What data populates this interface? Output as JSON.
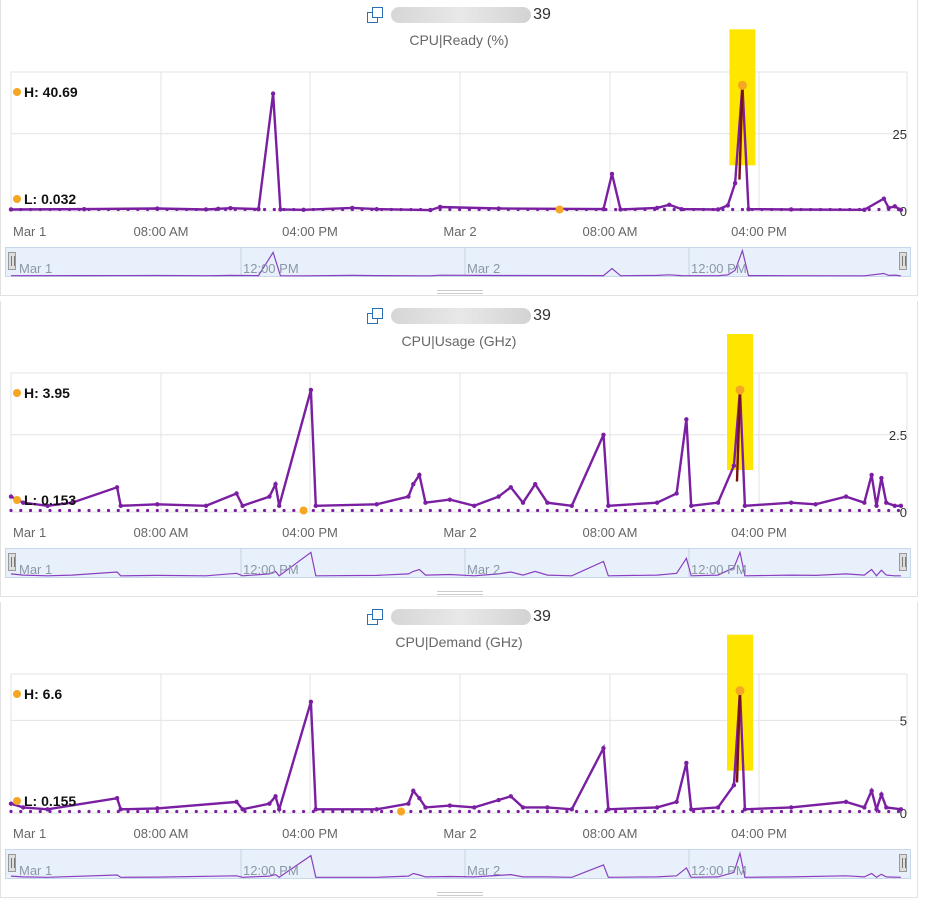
{
  "colors": {
    "series": "#7a1fa2",
    "marker": "#f5a623",
    "highlight": "#ffe600",
    "grid": "#e3e3e3",
    "nav_bg": "#e8f1fb"
  },
  "icons": {
    "object": "virtual-machine-icon"
  },
  "x_axis_labels": [
    "Mar 1",
    "08:00 AM",
    "04:00 PM",
    "Mar 2",
    "08:00 AM",
    "04:00 PM"
  ],
  "navigator_labels": [
    "Mar 1",
    "12:00 PM",
    "Mar 2",
    "12:00 PM"
  ],
  "panels": [
    {
      "object_suffix": "39",
      "metric": "CPU|Ready (%)",
      "high_label": "H: 40.69",
      "low_label": "L: 0.032",
      "yticks": [
        "25",
        "0"
      ]
    },
    {
      "object_suffix": "39",
      "metric": "CPU|Usage (GHz)",
      "high_label": "H: 3.95",
      "low_label": "L: 0.153",
      "yticks": [
        "2.5",
        "0"
      ]
    },
    {
      "object_suffix": "39",
      "metric": "CPU|Demand (GHz)",
      "high_label": "H: 6.6",
      "low_label": "L: 0.155",
      "yticks": [
        "5",
        "0"
      ]
    }
  ],
  "chart_data": [
    {
      "type": "line",
      "title": "CPU|Ready (%)",
      "x_range_hours": [
        0,
        48
      ],
      "ylim": [
        0,
        45
      ],
      "y_ticks": [
        0,
        25
      ],
      "high": 40.69,
      "low": 0.032,
      "series": [
        {
          "points": [
            [
              0,
              0.5
            ],
            [
              6,
              0.6
            ],
            [
              12,
              0.8
            ],
            [
              16,
              0.5
            ],
            [
              17,
              0.7
            ],
            [
              18,
              0.9
            ],
            [
              20.3,
              0.6
            ],
            [
              21.5,
              38
            ],
            [
              22.1,
              0.5
            ],
            [
              24,
              0.4
            ],
            [
              28,
              1.0
            ],
            [
              30,
              0.6
            ],
            [
              34.4,
              0.3
            ],
            [
              35.2,
              1.3
            ],
            [
              40,
              0.8
            ],
            [
              48.6,
              0.6
            ],
            [
              49.3,
              12
            ],
            [
              50,
              0.5
            ],
            [
              53,
              1.0
            ],
            [
              54,
              2.0
            ],
            [
              55,
              0.6
            ],
            [
              58,
              0.5
            ],
            [
              58.8,
              1.8
            ],
            [
              59.4,
              9
            ],
            [
              60,
              40.69
            ],
            [
              60.5,
              0.6
            ],
            [
              64,
              0.5
            ],
            [
              70,
              0.4
            ],
            [
              71.6,
              4
            ],
            [
              72,
              1.0
            ],
            [
              72.5,
              1.5
            ],
            [
              73,
              0.4
            ]
          ]
        }
      ]
    },
    {
      "type": "line",
      "title": "CPU|Usage (GHz)",
      "x_range_hours": [
        0,
        48
      ],
      "ylim": [
        0,
        4.5
      ],
      "y_ticks": [
        0,
        2.5
      ],
      "high": 3.95,
      "low": 0.153,
      "series": [
        {
          "points": [
            [
              0,
              0.5
            ],
            [
              1,
              0.3
            ],
            [
              3,
              0.2
            ],
            [
              5,
              0.3
            ],
            [
              8.7,
              0.8
            ],
            [
              9,
              0.2
            ],
            [
              12,
              0.25
            ],
            [
              16,
              0.2
            ],
            [
              18.5,
              0.6
            ],
            [
              19,
              0.2
            ],
            [
              21.2,
              0.5
            ],
            [
              21.7,
              0.9
            ],
            [
              22,
              0.2
            ],
            [
              24.6,
              3.95
            ],
            [
              25,
              0.2
            ],
            [
              30,
              0.25
            ],
            [
              32.6,
              0.5
            ],
            [
              33,
              0.9
            ],
            [
              33.5,
              1.2
            ],
            [
              34,
              0.3
            ],
            [
              36,
              0.4
            ],
            [
              38,
              0.2
            ],
            [
              40,
              0.5
            ],
            [
              41,
              0.8
            ],
            [
              42,
              0.3
            ],
            [
              43,
              0.9
            ],
            [
              44,
              0.3
            ],
            [
              46,
              0.2
            ],
            [
              48.6,
              2.5
            ],
            [
              49,
              0.2
            ],
            [
              53,
              0.3
            ],
            [
              54.6,
              0.6
            ],
            [
              55.4,
              3.0
            ],
            [
              55.8,
              0.2
            ],
            [
              58,
              0.3
            ],
            [
              59.3,
              1.5
            ],
            [
              59.8,
              3.95
            ],
            [
              60.2,
              0.2
            ],
            [
              64,
              0.3
            ],
            [
              66,
              0.25
            ],
            [
              68.5,
              0.5
            ],
            [
              70,
              0.3
            ],
            [
              70.6,
              1.2
            ],
            [
              71,
              0.2
            ],
            [
              71.4,
              1.1
            ],
            [
              71.8,
              0.3
            ],
            [
              72.5,
              0.2
            ],
            [
              73,
              0.2
            ]
          ]
        }
      ]
    },
    {
      "type": "line",
      "title": "CPU|Demand (GHz)",
      "x_range_hours": [
        0,
        48
      ],
      "ylim": [
        0,
        7.5
      ],
      "y_ticks": [
        0,
        5
      ],
      "high": 6.6,
      "low": 0.155,
      "series": [
        {
          "points": [
            [
              0,
              0.5
            ],
            [
              1,
              0.3
            ],
            [
              3,
              0.2
            ],
            [
              8.7,
              0.8
            ],
            [
              9,
              0.2
            ],
            [
              12,
              0.25
            ],
            [
              18.5,
              0.6
            ],
            [
              19,
              0.2
            ],
            [
              21.2,
              0.5
            ],
            [
              21.7,
              0.9
            ],
            [
              22,
              0.2
            ],
            [
              24.6,
              6.0
            ],
            [
              25,
              0.2
            ],
            [
              30,
              0.2
            ],
            [
              32.6,
              0.5
            ],
            [
              33,
              1.2
            ],
            [
              33.5,
              0.8
            ],
            [
              34,
              0.3
            ],
            [
              36,
              0.4
            ],
            [
              38,
              0.3
            ],
            [
              40,
              0.7
            ],
            [
              41,
              0.9
            ],
            [
              42,
              0.3
            ],
            [
              44,
              0.3
            ],
            [
              46,
              0.2
            ],
            [
              48.6,
              3.5
            ],
            [
              49,
              0.2
            ],
            [
              53,
              0.3
            ],
            [
              54.6,
              0.6
            ],
            [
              55.4,
              2.7
            ],
            [
              55.8,
              0.2
            ],
            [
              58,
              0.3
            ],
            [
              59.3,
              1.5
            ],
            [
              59.8,
              6.6
            ],
            [
              60.2,
              0.2
            ],
            [
              64,
              0.3
            ],
            [
              68.5,
              0.6
            ],
            [
              70,
              0.3
            ],
            [
              70.6,
              1.2
            ],
            [
              71,
              0.2
            ],
            [
              71.4,
              1.0
            ],
            [
              71.8,
              0.3
            ],
            [
              73,
              0.2
            ]
          ]
        }
      ]
    }
  ]
}
